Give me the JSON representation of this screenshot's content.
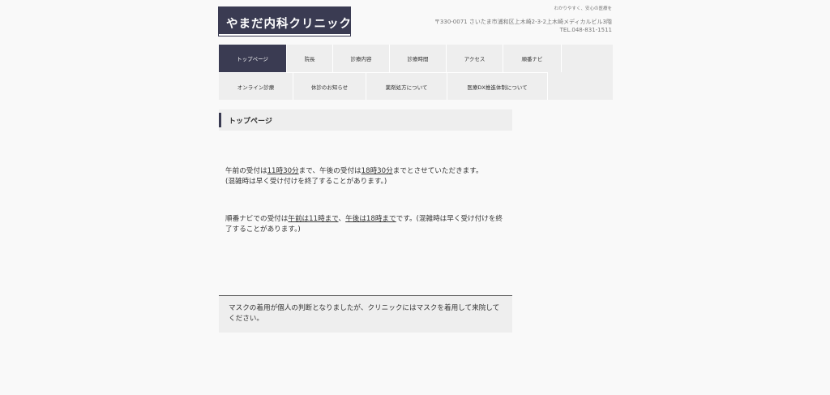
{
  "header": {
    "logo_text": "やまだ内科クリニック",
    "tagline": "わかりやすく、安心の医療を",
    "address": "〒330-0071 さいたま市浦和区上木崎2-3-2上木崎メディカルビル3階",
    "tel": "TEL.048-831-1511"
  },
  "nav": {
    "items": [
      {
        "label": "トップページ"
      },
      {
        "label": "院長"
      },
      {
        "label": "診療内容"
      },
      {
        "label": "診療時間"
      },
      {
        "label": "アクセス"
      },
      {
        "label": "順番ナビ"
      },
      {
        "label": "オンライン診療"
      },
      {
        "label": "休診のお知らせ"
      },
      {
        "label": "薬剤処方について"
      },
      {
        "label": "医療DX推進体制について"
      }
    ],
    "active_index": 0
  },
  "content": {
    "title": "トップページ",
    "para1": {
      "t1": "午前の受付は",
      "u1": "11時30分",
      "t2": "まで、午後の受付は",
      "u2": "18時30分",
      "t3": "までとさせていただきます。",
      "t4": "(混雑時は早く受け付けを終了することがあります。)"
    },
    "para2": {
      "t1": "順番ナビでの受付は",
      "u1": "午前は11時まで",
      "t2": "、",
      "u2": "午後は18時まで",
      "t3": "です。(混雑時は早く受け付けを終了することがあります。)"
    },
    "notice": "マスクの着用が個人の判断となりましたが、クリニックにはマスクを着用して来院してください。"
  },
  "colors": {
    "accent": "#3a3b52",
    "background": "#f9f9f9",
    "panel": "#eeeeee"
  }
}
